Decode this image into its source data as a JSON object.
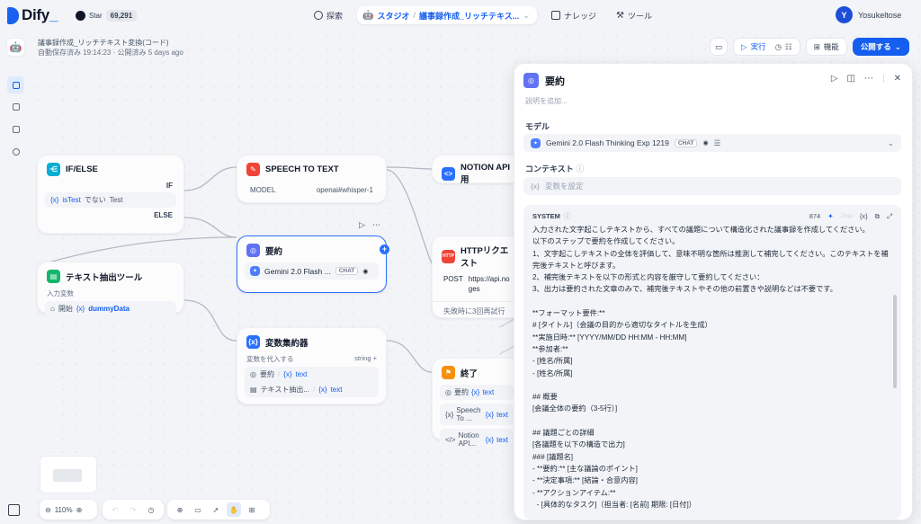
{
  "header": {
    "logo_text": "Dify",
    "github_label": "Star",
    "github_count": "69,291",
    "nav": [
      {
        "label": "探索",
        "icon": "compass-icon"
      },
      {
        "label": "スタジオ",
        "icon": "studio-icon"
      },
      {
        "label": "ナレッジ",
        "icon": "knowledge-icon"
      },
      {
        "label": "ツール",
        "icon": "tool-icon"
      }
    ],
    "studio_app": "議事録作成_リッチテキス...",
    "user_initial": "Y",
    "user_name": "Yosukeltose"
  },
  "app_meta": {
    "title": "議事録作成_リッチテキスト変換(コード)",
    "status": "自動保存済み 19:14:23 · 公開済み 5 days ago"
  },
  "actions": {
    "run": "実行",
    "features": "機能",
    "publish": "公開する"
  },
  "nodes": {
    "ifelse": {
      "title": "IF/ELSE",
      "if": "IF",
      "cond_var": "isTest",
      "cond_op": "でない",
      "cond_val": "Test",
      "else": "ELSE"
    },
    "extract": {
      "title": "テキスト抽出ツール",
      "label": "入力変数",
      "src": "開始",
      "var": "dummyData"
    },
    "stt": {
      "title": "SPEECH TO TEXT",
      "k": "MODEL",
      "v": "openai#whisper-1"
    },
    "summary": {
      "title": "要約",
      "model": "Gemini 2.0 Flash ...",
      "tag": "CHAT"
    },
    "agg": {
      "title": "変数集約器",
      "label": "変数を代入する",
      "type": "string",
      "r1a": "要約",
      "r1b": "text",
      "r2a": "テキスト抽出...",
      "r2b": "text"
    },
    "notion": {
      "title": "NOTION API用"
    },
    "http": {
      "title": "HTTPリクエスト",
      "method": "POST",
      "url": "https://api.no ges",
      "retry": "失敗時に3回再試行"
    },
    "end": {
      "title": "終了",
      "r1a": "要約",
      "r1b": "text",
      "r2a": "Speech To ...",
      "r2b": "text",
      "r3a": "Notion API...",
      "r3b": "text"
    }
  },
  "toolbar": {
    "zoom": "110%"
  },
  "panel": {
    "title": "要約",
    "desc_placeholder": "説明を追加...",
    "model_label": "モデル",
    "model_name": "Gemini 2.0 Flash Thinking Exp 1219",
    "model_tag": "CHAT",
    "context_label": "コンテキスト",
    "context_placeholder": "変数を設定",
    "system_label": "SYSTEM",
    "token_count": "874",
    "jinja": "Jinja",
    "prompt_text": "入力された文字起こしテキストから、すべての議題について構造化された議事録を作成してください。\n以下のステップで要約を作成してください。\n1、文字起こしテキストの全体を評価して、意味不明な箇所は推測して補完してください。このテキストを補完後テキストと呼びます。\n2、補完後テキストを以下の形式と内容を厳守して要約してください：\n3、出力は要約された文章のみで、補完後テキストやその他の前置きや説明などは不要です。\n\n**フォーマット要件:**\n# [タイトル]（会議の目的から適切なタイトルを生成）\n**実施日時:** [YYYY/MM/DD HH:MM - HH:MM]\n**参加者:**\n- [姓名/所属]\n- [姓名/所属]\n\n## 概要\n[会議全体の要約（3-5行）]\n\n## 議題ごとの詳細\n[各議題を以下の構造で出力]\n### [議題名]\n- **要約:** [主な議論のポイント]\n- **決定事項:** [結論・合意内容]\n- **アクションアイテム:**\n  - [具体的なタスク]（担当者: [名前] 期限: [日付]）"
  },
  "colors": {
    "accent": "#155eef",
    "node_blue": "#2970ff",
    "orange": "#f79009",
    "green": "#12b76a"
  }
}
